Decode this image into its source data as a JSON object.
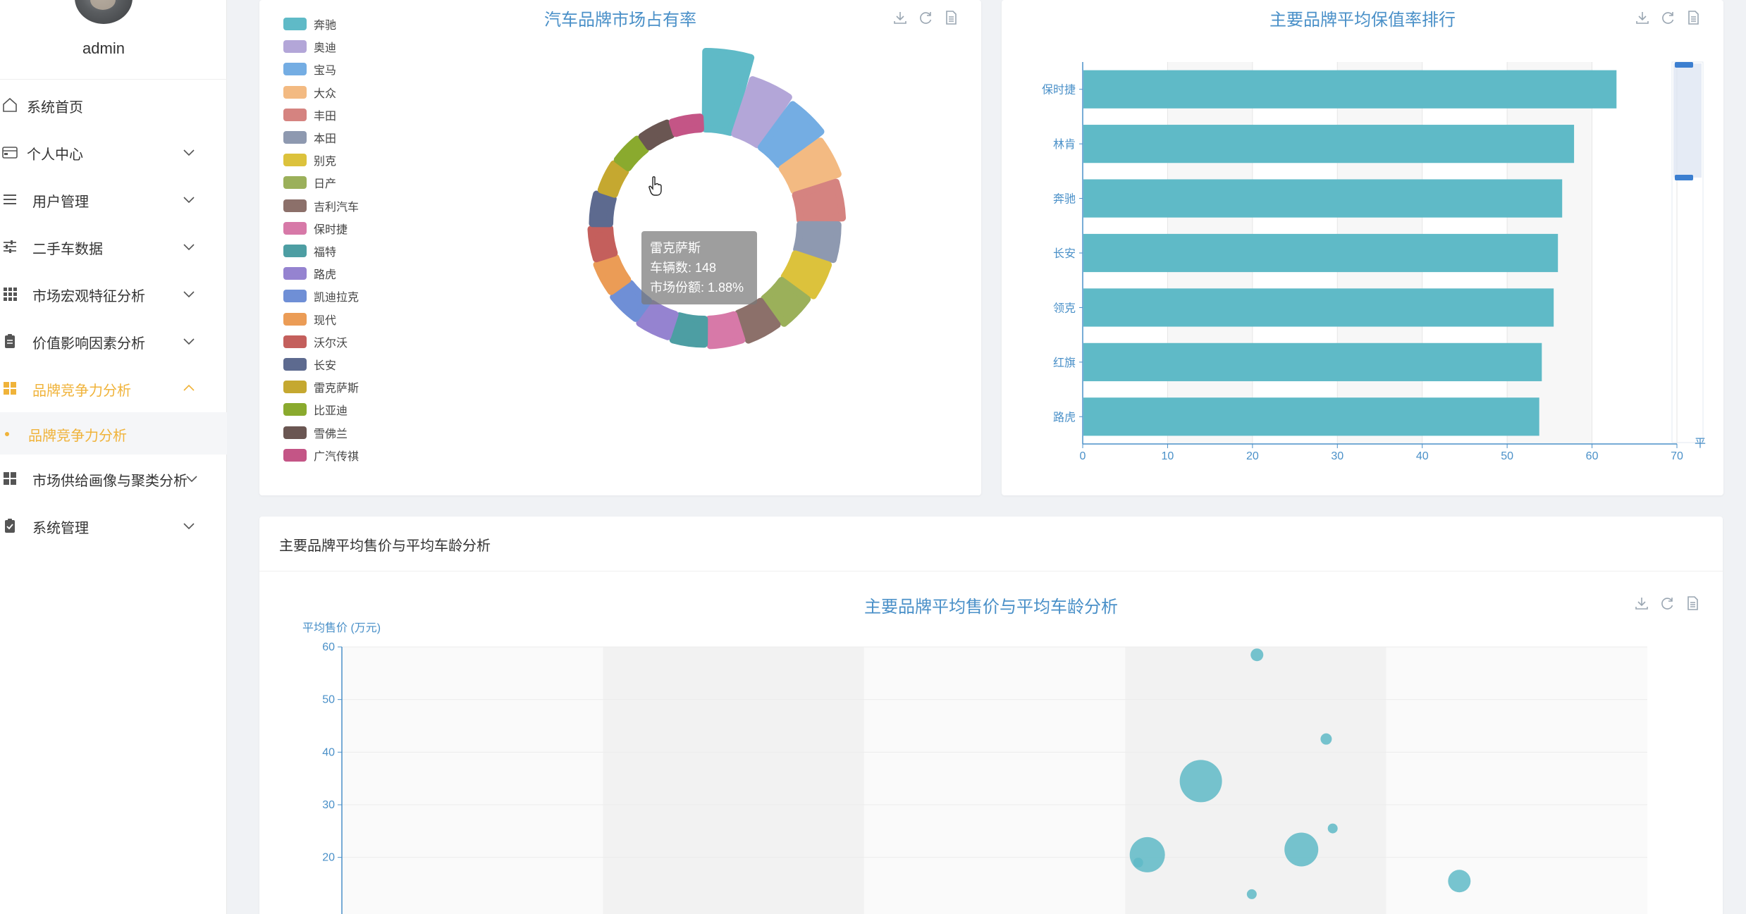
{
  "sidebar": {
    "username": "admin",
    "items": [
      {
        "label": "系统首页",
        "icon": "home-icon"
      },
      {
        "label": "个人中心",
        "icon": "card-icon"
      },
      {
        "label": "用户管理",
        "icon": "list-icon"
      },
      {
        "label": "二手车数据",
        "icon": "sliders-icon"
      },
      {
        "label": "市场宏观特征分析",
        "icon": "grid-icon"
      },
      {
        "label": "价值影响因素分析",
        "icon": "clipboard-icon"
      },
      {
        "label": "品牌竞争力分析",
        "icon": "grid-active-icon"
      },
      {
        "label": "市场供给画像与聚类分析",
        "icon": "grid-icon"
      },
      {
        "label": "系统管理",
        "icon": "clipboard-check-icon"
      }
    ],
    "active_sub": "品牌竞争力分析"
  },
  "pie": {
    "title": "汽车品牌市场占有率",
    "tooltip": {
      "name": "雷克萨斯",
      "count": "车辆数: 148",
      "share": "市场份额: 1.88%"
    }
  },
  "bar": {
    "title": "主要品牌平均保值率排行",
    "slider_label": "平"
  },
  "section": {
    "header": "主要品牌平均售价与平均车龄分析"
  },
  "scatter": {
    "title": "主要品牌平均售价与平均车龄分析"
  },
  "chart_data": [
    {
      "type": "pie",
      "title": "汽车品牌市场占有率",
      "categories": [
        "奔驰",
        "奥迪",
        "宝马",
        "大众",
        "丰田",
        "本田",
        "别克",
        "日产",
        "吉利汽车",
        "保时捷",
        "福特",
        "路虎",
        "凯迪拉克",
        "现代",
        "沃尔沃",
        "长安",
        "雷克萨斯",
        "比亚迪",
        "雪佛兰",
        "广汽传祺"
      ],
      "values": [
        10.2,
        7.5,
        7.0,
        6.2,
        5.6,
        5.0,
        4.6,
        4.2,
        3.8,
        3.5,
        3.3,
        3.1,
        2.9,
        2.7,
        2.5,
        2.3,
        1.88,
        1.8,
        1.7,
        1.6
      ],
      "colors": [
        "#5fbac7",
        "#b3a6d8",
        "#74ade3",
        "#f3ba82",
        "#d58380",
        "#8e99b0",
        "#dcc23c",
        "#9bb05a",
        "#8c706a",
        "#d779a8",
        "#4d9ea3",
        "#9583d0",
        "#6f8fd6",
        "#eb9c56",
        "#c45f5c",
        "#5d6a8f",
        "#c5a830",
        "#8aaa2e",
        "#6a5652",
        "#c45586"
      ],
      "legend": "left"
    },
    {
      "type": "bar",
      "title": "主要品牌平均保值率排行",
      "categories": [
        "保时捷",
        "林肯",
        "奔驰",
        "长安",
        "领克",
        "红旗",
        "路虎"
      ],
      "values": [
        62.8,
        57.8,
        56.4,
        55.9,
        55.4,
        54.0,
        53.7
      ],
      "xlim": [
        0,
        70
      ],
      "xticks": [
        0,
        10,
        20,
        30,
        40,
        50,
        60,
        70
      ],
      "orientation": "horizontal",
      "color": "#5fbac7"
    },
    {
      "type": "scatter",
      "title": "主要品牌平均售价与平均车龄分析",
      "ylabel": "平均售价 (万元)",
      "ylim": [
        0,
        60
      ],
      "yticks": [
        20,
        30,
        40,
        50,
        60
      ],
      "points": [
        {
          "x": 0.701,
          "y": 58.5,
          "r": 9
        },
        {
          "x": 0.754,
          "y": 42.5,
          "r": 8
        },
        {
          "x": 0.658,
          "y": 34.5,
          "r": 30
        },
        {
          "x": 0.759,
          "y": 25.5,
          "r": 7
        },
        {
          "x": 0.735,
          "y": 21.5,
          "r": 24
        },
        {
          "x": 0.617,
          "y": 20.5,
          "r": 25
        },
        {
          "x": 0.61,
          "y": 19.0,
          "r": 7
        },
        {
          "x": 0.856,
          "y": 15.5,
          "r": 16
        },
        {
          "x": 0.697,
          "y": 13.0,
          "r": 7
        }
      ],
      "color": "#5fbac7"
    }
  ]
}
